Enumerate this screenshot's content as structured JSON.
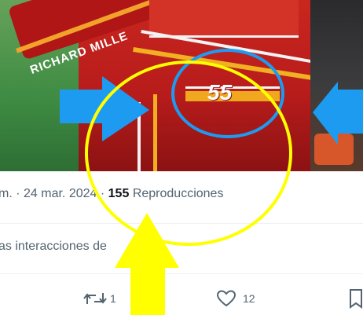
{
  "photo": {
    "sponsor_text": "RICHARD MILLE",
    "race_number": "55"
  },
  "tweet_meta": {
    "time_fragment": "m.",
    "separator1": "·",
    "date": "24 mar. 2024",
    "separator2": "·",
    "view_count": "155",
    "views_label": "Reproducciones"
  },
  "interactions_link": "as interacciones de",
  "actions": {
    "retweet_count": "1",
    "like_count": "12"
  },
  "icons": [
    "retweet-icon",
    "heart-icon",
    "bookmark-icon"
  ],
  "annotations": {
    "arrow_color": "#1d9bf0",
    "circle_blue_color": "#1d9bf0",
    "circle_yellow_color": "#ffff00",
    "yellow_arrow_color": "#ffff00"
  },
  "colors": {
    "text_primary": "#0f1419",
    "text_secondary": "#536471",
    "divider": "#eff3f4"
  }
}
